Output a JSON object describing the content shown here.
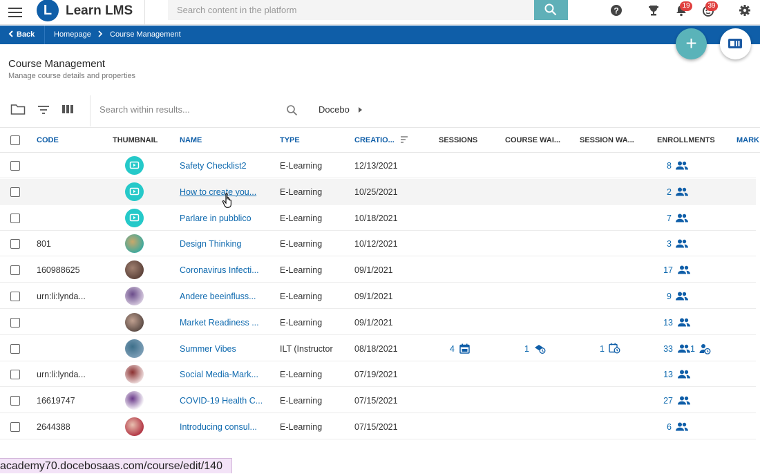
{
  "app": {
    "logo_letter": "L",
    "title": "Learn LMS"
  },
  "search": {
    "placeholder": "Search content in the platform"
  },
  "badges": {
    "notifications": "19",
    "messages": "39"
  },
  "breadcrumb": {
    "back": "Back",
    "home": "Homepage",
    "current": "Course Management"
  },
  "page": {
    "title": "Course Management",
    "subtitle": "Manage course details and properties"
  },
  "toolbar": {
    "search_placeholder": "Search within results...",
    "source": "Docebo"
  },
  "columns": {
    "code": "CODE",
    "thumbnail": "THUMBNAIL",
    "name": "NAME",
    "type": "TYPE",
    "creation": "CREATIO...",
    "sessions": "SESSIONS",
    "course_wait": "COURSE WAI...",
    "session_wait": "SESSION WA...",
    "enrollments": "ENROLLMENTS",
    "more": "MARK"
  },
  "rows": [
    {
      "code": "",
      "thumb": "video",
      "name": "Safety Checklist2",
      "type": "E-Learning",
      "date": "12/13/2021",
      "enrollments": "8"
    },
    {
      "code": "",
      "thumb": "video",
      "name": "How to create you...",
      "type": "E-Learning",
      "date": "10/25/2021",
      "enrollments": "2"
    },
    {
      "code": "",
      "thumb": "video",
      "name": "Parlare in pubblico",
      "type": "E-Learning",
      "date": "10/18/2021",
      "enrollments": "7"
    },
    {
      "code": "801",
      "thumb": "image",
      "name": "Design Thinking",
      "type": "E-Learning",
      "date": "10/12/2021",
      "enrollments": "3"
    },
    {
      "code": "160988625",
      "thumb": "image",
      "name": "Coronavirus Infecti...",
      "type": "E-Learning",
      "date": "09/1/2021",
      "enrollments": "17"
    },
    {
      "code": "urn:li:lynda...",
      "thumb": "image",
      "name": "Andere beeinfluss...",
      "type": "E-Learning",
      "date": "09/1/2021",
      "enrollments": "9"
    },
    {
      "code": "",
      "thumb": "image",
      "name": "Market Readiness ...",
      "type": "E-Learning",
      "date": "09/1/2021",
      "enrollments": "13"
    },
    {
      "code": "",
      "thumb": "image",
      "name": "Summer Vibes",
      "type": "ILT (Instructor",
      "date": "08/18/2021",
      "enrollments": "33",
      "sessions": "4",
      "course_wait": "1",
      "session_wait": "1",
      "enroll_extra": "1"
    },
    {
      "code": "urn:li:lynda...",
      "thumb": "image",
      "name": "Social Media-Mark...",
      "type": "E-Learning",
      "date": "07/19/2021",
      "enrollments": "13"
    },
    {
      "code": "16619747",
      "thumb": "image",
      "name": "COVID-19 Health C...",
      "type": "E-Learning",
      "date": "07/15/2021",
      "enrollments": "27"
    },
    {
      "code": "2644388",
      "thumb": "image",
      "name": "Introducing consul...",
      "type": "E-Learning",
      "date": "07/15/2021",
      "enrollments": "6"
    }
  ],
  "status_url": "academy70.docebosaas.com/course/edit/140"
}
